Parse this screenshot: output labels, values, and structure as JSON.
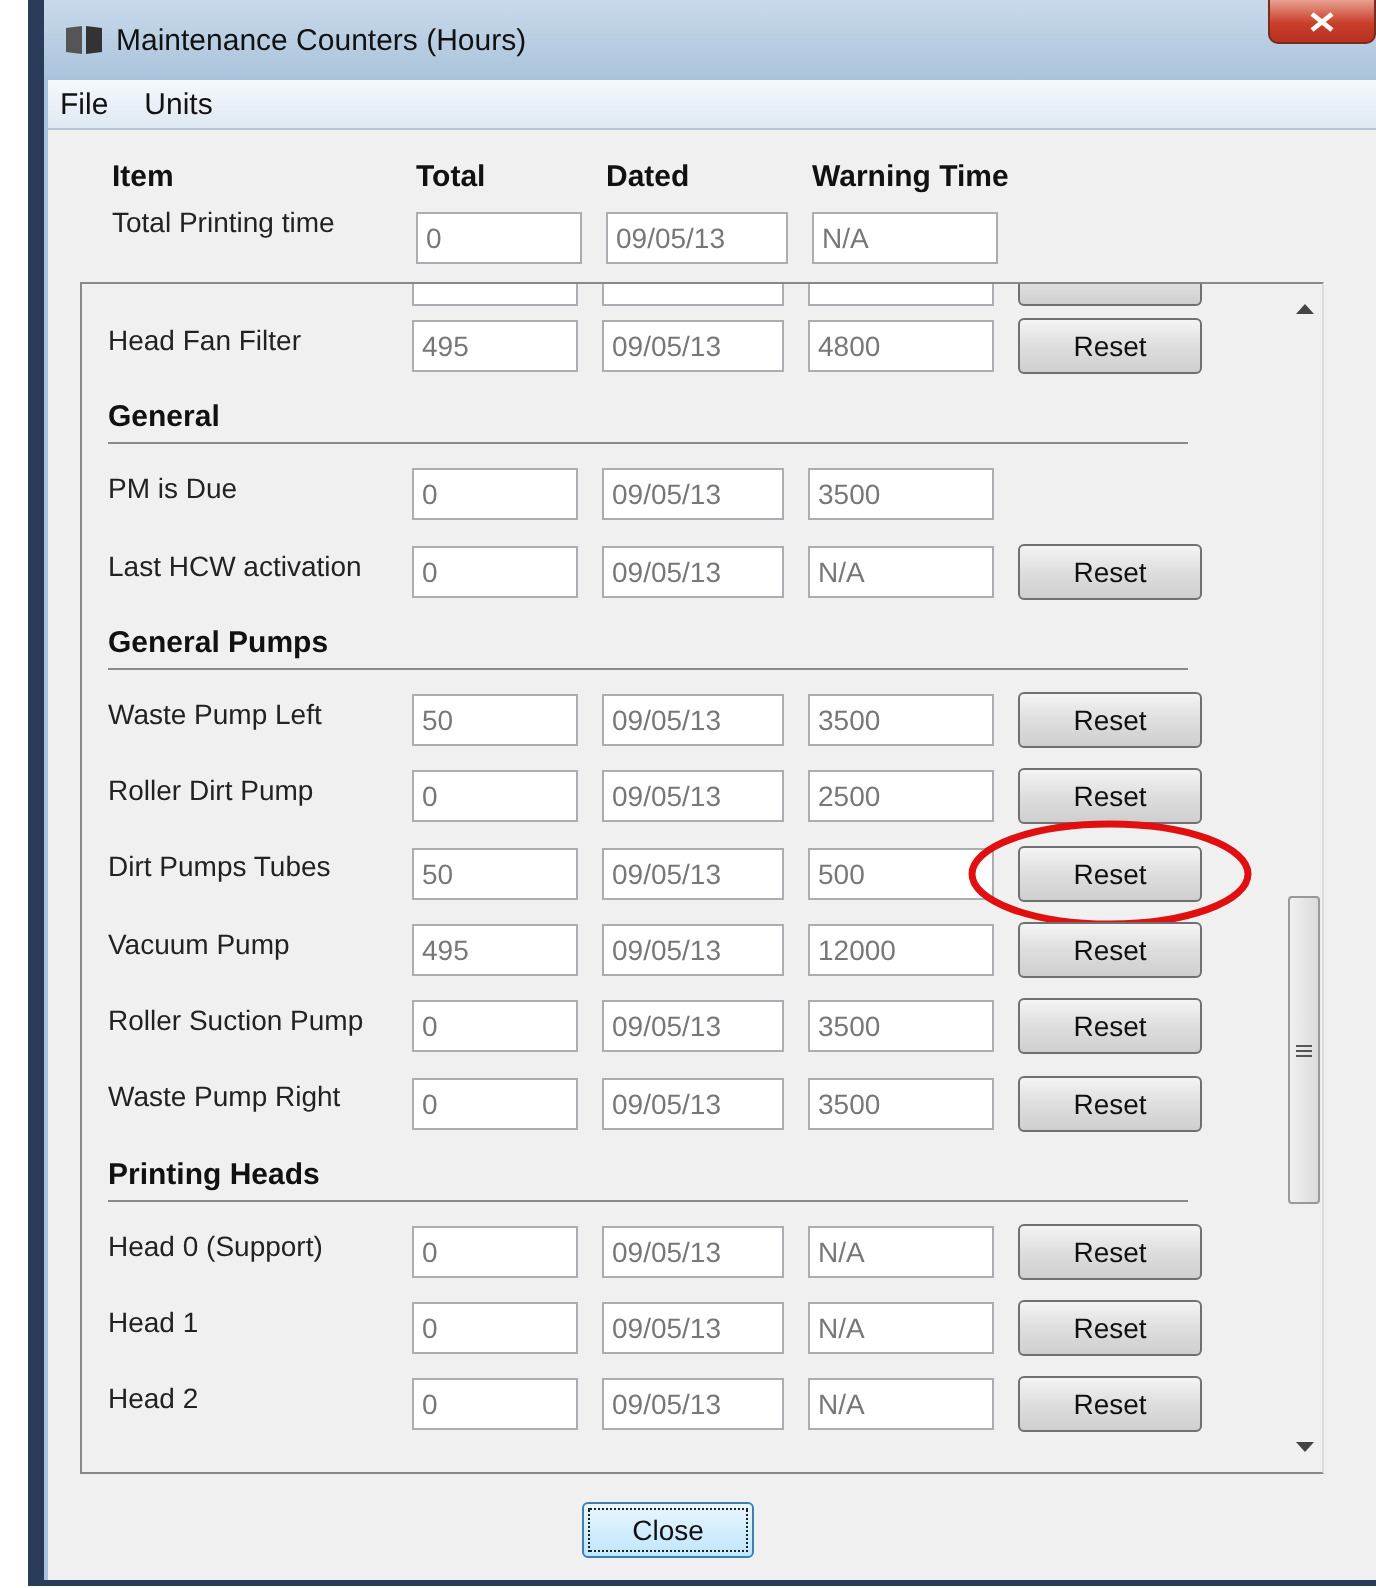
{
  "window": {
    "title": "Maintenance Counters (Hours)"
  },
  "menu": [
    "File",
    "Units"
  ],
  "columns": [
    "Item",
    "Total",
    "Dated",
    "Warning Time"
  ],
  "total_row": {
    "label": "Total Printing time",
    "total": "0",
    "dated": "09/05/13",
    "warning": "N/A"
  },
  "sections": [
    {
      "rows": [
        {
          "label": "Head Fan Filter",
          "total": "495",
          "dated": "09/05/13",
          "warning": "4800",
          "reset": "Reset",
          "circled": false
        }
      ]
    },
    {
      "title": "General",
      "rows": [
        {
          "label": "PM is Due",
          "total": "0",
          "dated": "09/05/13",
          "warning": "3500",
          "circled": false
        },
        {
          "label": "Last HCW activation",
          "total": "0",
          "dated": "09/05/13",
          "warning": "N/A",
          "reset": "Reset",
          "circled": false
        }
      ]
    },
    {
      "title": "General Pumps",
      "rows": [
        {
          "label": "Waste Pump Left",
          "total": "50",
          "dated": "09/05/13",
          "warning": "3500",
          "reset": "Reset",
          "circled": false
        },
        {
          "label": "Roller Dirt Pump",
          "total": "0",
          "dated": "09/05/13",
          "warning": "2500",
          "reset": "Reset",
          "circled": false
        },
        {
          "label": "Dirt Pumps Tubes",
          "total": "50",
          "dated": "09/05/13",
          "warning": "500",
          "reset": "Reset",
          "circled": true
        },
        {
          "label": "Vacuum Pump",
          "total": "495",
          "dated": "09/05/13",
          "warning": "12000",
          "reset": "Reset",
          "circled": false
        },
        {
          "label": "Roller Suction Pump",
          "total": "0",
          "dated": "09/05/13",
          "warning": "3500",
          "reset": "Reset",
          "circled": false
        },
        {
          "label": "Waste Pump Right",
          "total": "0",
          "dated": "09/05/13",
          "warning": "3500",
          "reset": "Reset",
          "circled": false
        }
      ]
    },
    {
      "title": "Printing Heads",
      "rows": [
        {
          "label": "Head 0 (Support)",
          "total": "0",
          "dated": "09/05/13",
          "warning": "N/A",
          "reset": "Reset",
          "circled": false
        },
        {
          "label": "Head 1",
          "total": "0",
          "dated": "09/05/13",
          "warning": "N/A",
          "reset": "Reset",
          "circled": false
        },
        {
          "label": "Head 2",
          "total": "0",
          "dated": "09/05/13",
          "warning": "N/A",
          "reset": "Reset",
          "circled": false
        }
      ]
    }
  ],
  "close_button": "Close"
}
